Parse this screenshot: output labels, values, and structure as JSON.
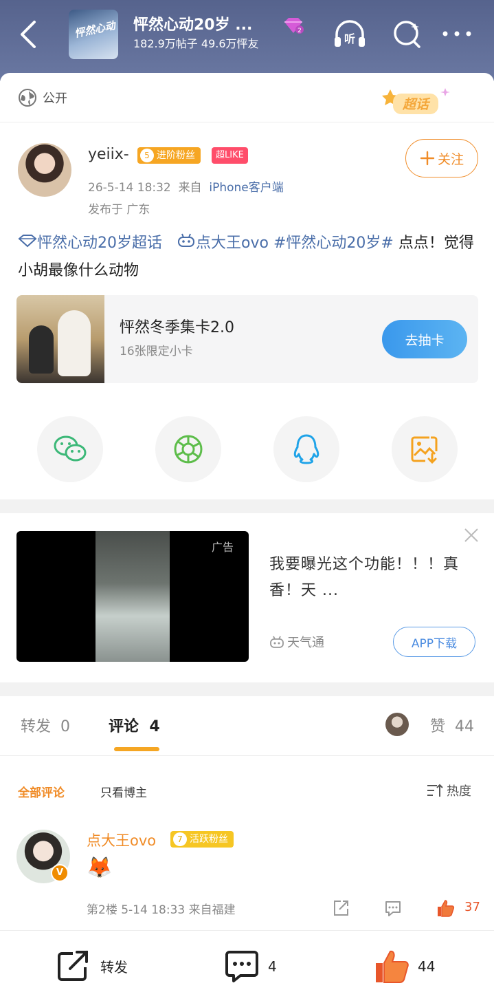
{
  "header": {
    "title": "怦然心动20岁 ...",
    "cover_text": "怦然心动",
    "posts": "182.9万帖子",
    "fans": "49.6万怦友",
    "gem_level": "2",
    "listen_label": "听"
  },
  "visibility": "公开",
  "super_topic_tag": "超话",
  "post": {
    "username": "yeiix-",
    "fan_level": "5",
    "fan_badge": "进阶粉丝",
    "like_badge": "超LIKE",
    "time": "26-5-14 18:32",
    "from_prefix": "来自",
    "device": "iPhone客户端",
    "location": "发布于 广东",
    "follow_label": "关注",
    "topic_link": "怦然心动20岁超话",
    "mention": "点大王ovo",
    "hashtag": "#怦然心动20岁#",
    "body": "点点！觉得小胡最像什么动物"
  },
  "promo_card": {
    "title": "怦然冬季集卡2.0",
    "subtitle": "16张限定小卡",
    "button": "去抽卡"
  },
  "share_icons": [
    "wechat-icon",
    "moments-icon",
    "qq-icon",
    "save-image-icon"
  ],
  "ad": {
    "tag": "广告",
    "text": "我要曝光这个功能！！！真香！天 ...",
    "source": "天气通",
    "button": "APP下载"
  },
  "tabs": {
    "repost_label": "转发",
    "repost_count": "0",
    "comment_label": "评论",
    "comment_count": "4",
    "like_label": "赞",
    "like_count": "44"
  },
  "filters": {
    "all": "全部评论",
    "author_only": "只看博主",
    "sort": "热度"
  },
  "comment": {
    "name": "点大王ovo",
    "level": "7",
    "badge": "活跃粉丝",
    "verified": "V",
    "emoji": "🦊",
    "meta": "第2楼 5-14 18:33 来自福建",
    "likes": "37"
  },
  "bottom": {
    "repost_label": "转发",
    "comment_count": "4",
    "like_count": "44"
  },
  "colors": {
    "header_bg": "#5f6c97",
    "accent_orange": "#f08c28",
    "link_blue": "#4a6ea9",
    "button_blue": "#3a98ec"
  }
}
